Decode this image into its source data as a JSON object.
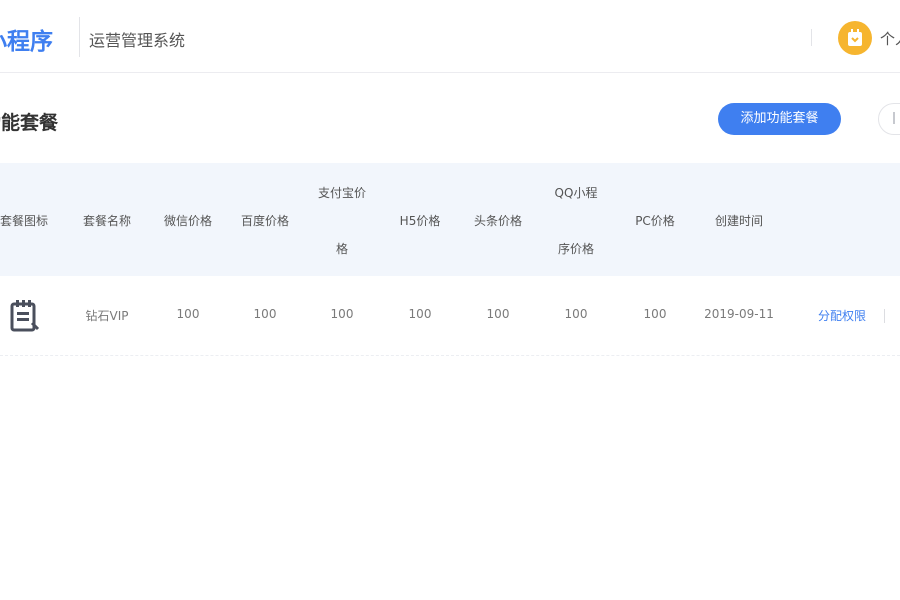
{
  "header": {
    "brand": "小程序",
    "subtitle": "运营管理系统",
    "user_label": "个人"
  },
  "page": {
    "title": "功能套餐",
    "add_button": "添加功能套餐"
  },
  "table": {
    "columns": {
      "icon": "套餐图标",
      "name": "套餐名称",
      "wechat": "微信价格",
      "baidu": "百度价格",
      "alipay_line1": "支付宝价",
      "alipay_line2": "格",
      "h5": "H5价格",
      "toutiao": "头条价格",
      "qq_line1": "QQ小程",
      "qq_line2": "序价格",
      "pc": "PC价格",
      "created": "创建时间"
    },
    "rows": [
      {
        "icon": "notepad-icon",
        "name": "钻石VIP",
        "wechat": "100",
        "baidu": "100",
        "alipay": "100",
        "h5": "100",
        "toutiao": "100",
        "qq": "100",
        "pc": "100",
        "created": "2019-09-11",
        "action": "分配权限"
      }
    ]
  },
  "colors": {
    "accent": "#3f7ff0",
    "avatar": "#f6b52f",
    "header_bg": "#f2f6fc"
  }
}
